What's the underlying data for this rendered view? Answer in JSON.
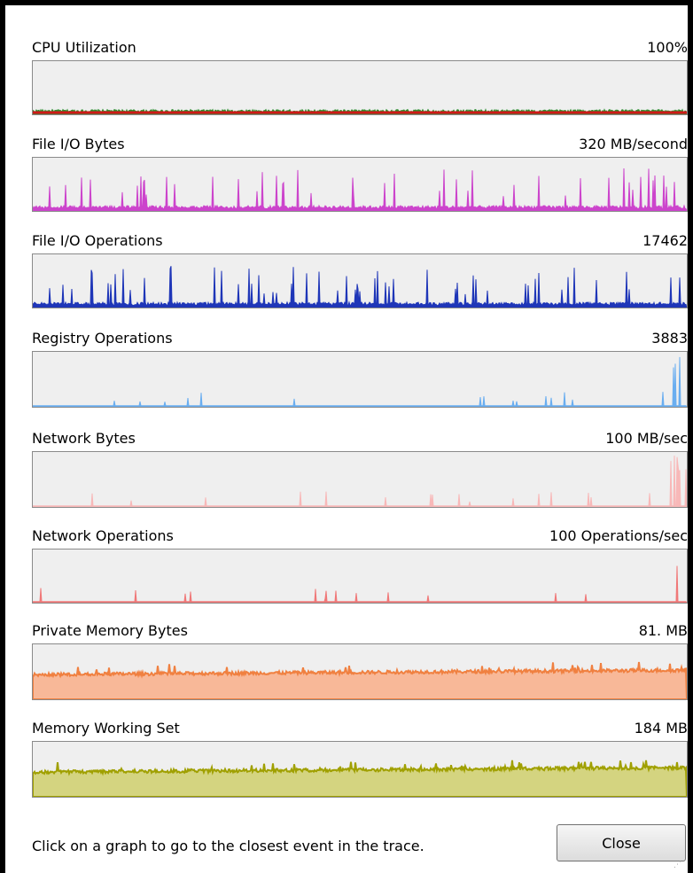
{
  "graphs": [
    {
      "title": "CPU Utilization",
      "max_label": "100%",
      "color": "#d01818",
      "color2": "#2e8b2e",
      "kind": "cpu",
      "fill": false
    },
    {
      "title": "File I/O Bytes",
      "max_label": "320 MB/second",
      "color": "#cc44cc",
      "kind": "spiky",
      "fill": false
    },
    {
      "title": "File I/O Operations",
      "max_label": "17462",
      "color": "#1f36b8",
      "kind": "spiky",
      "fill": false
    },
    {
      "title": "Registry Operations",
      "max_label": "3883",
      "color": "#6aaef0",
      "kind": "sparse",
      "fill": false
    },
    {
      "title": "Network Bytes",
      "max_label": "100 MB/sec",
      "color": "#f8b8b8",
      "kind": "sparse",
      "fill": false
    },
    {
      "title": "Network Operations",
      "max_label": "100 Operations/sec",
      "color": "#f07878",
      "kind": "sparse",
      "fill": false
    },
    {
      "title": "Private Memory Bytes",
      "max_label": "81. MB",
      "color": "#f08040",
      "fill_color": "#f8b898",
      "kind": "memory",
      "fill": true
    },
    {
      "title": "Memory Working Set",
      "max_label": "184 MB",
      "color": "#a0a000",
      "fill_color": "#d4d480",
      "kind": "memory",
      "fill": true
    }
  ],
  "footer": {
    "hint": "Click on a graph to go to the closest event in the trace.",
    "close_label": "Close"
  }
}
